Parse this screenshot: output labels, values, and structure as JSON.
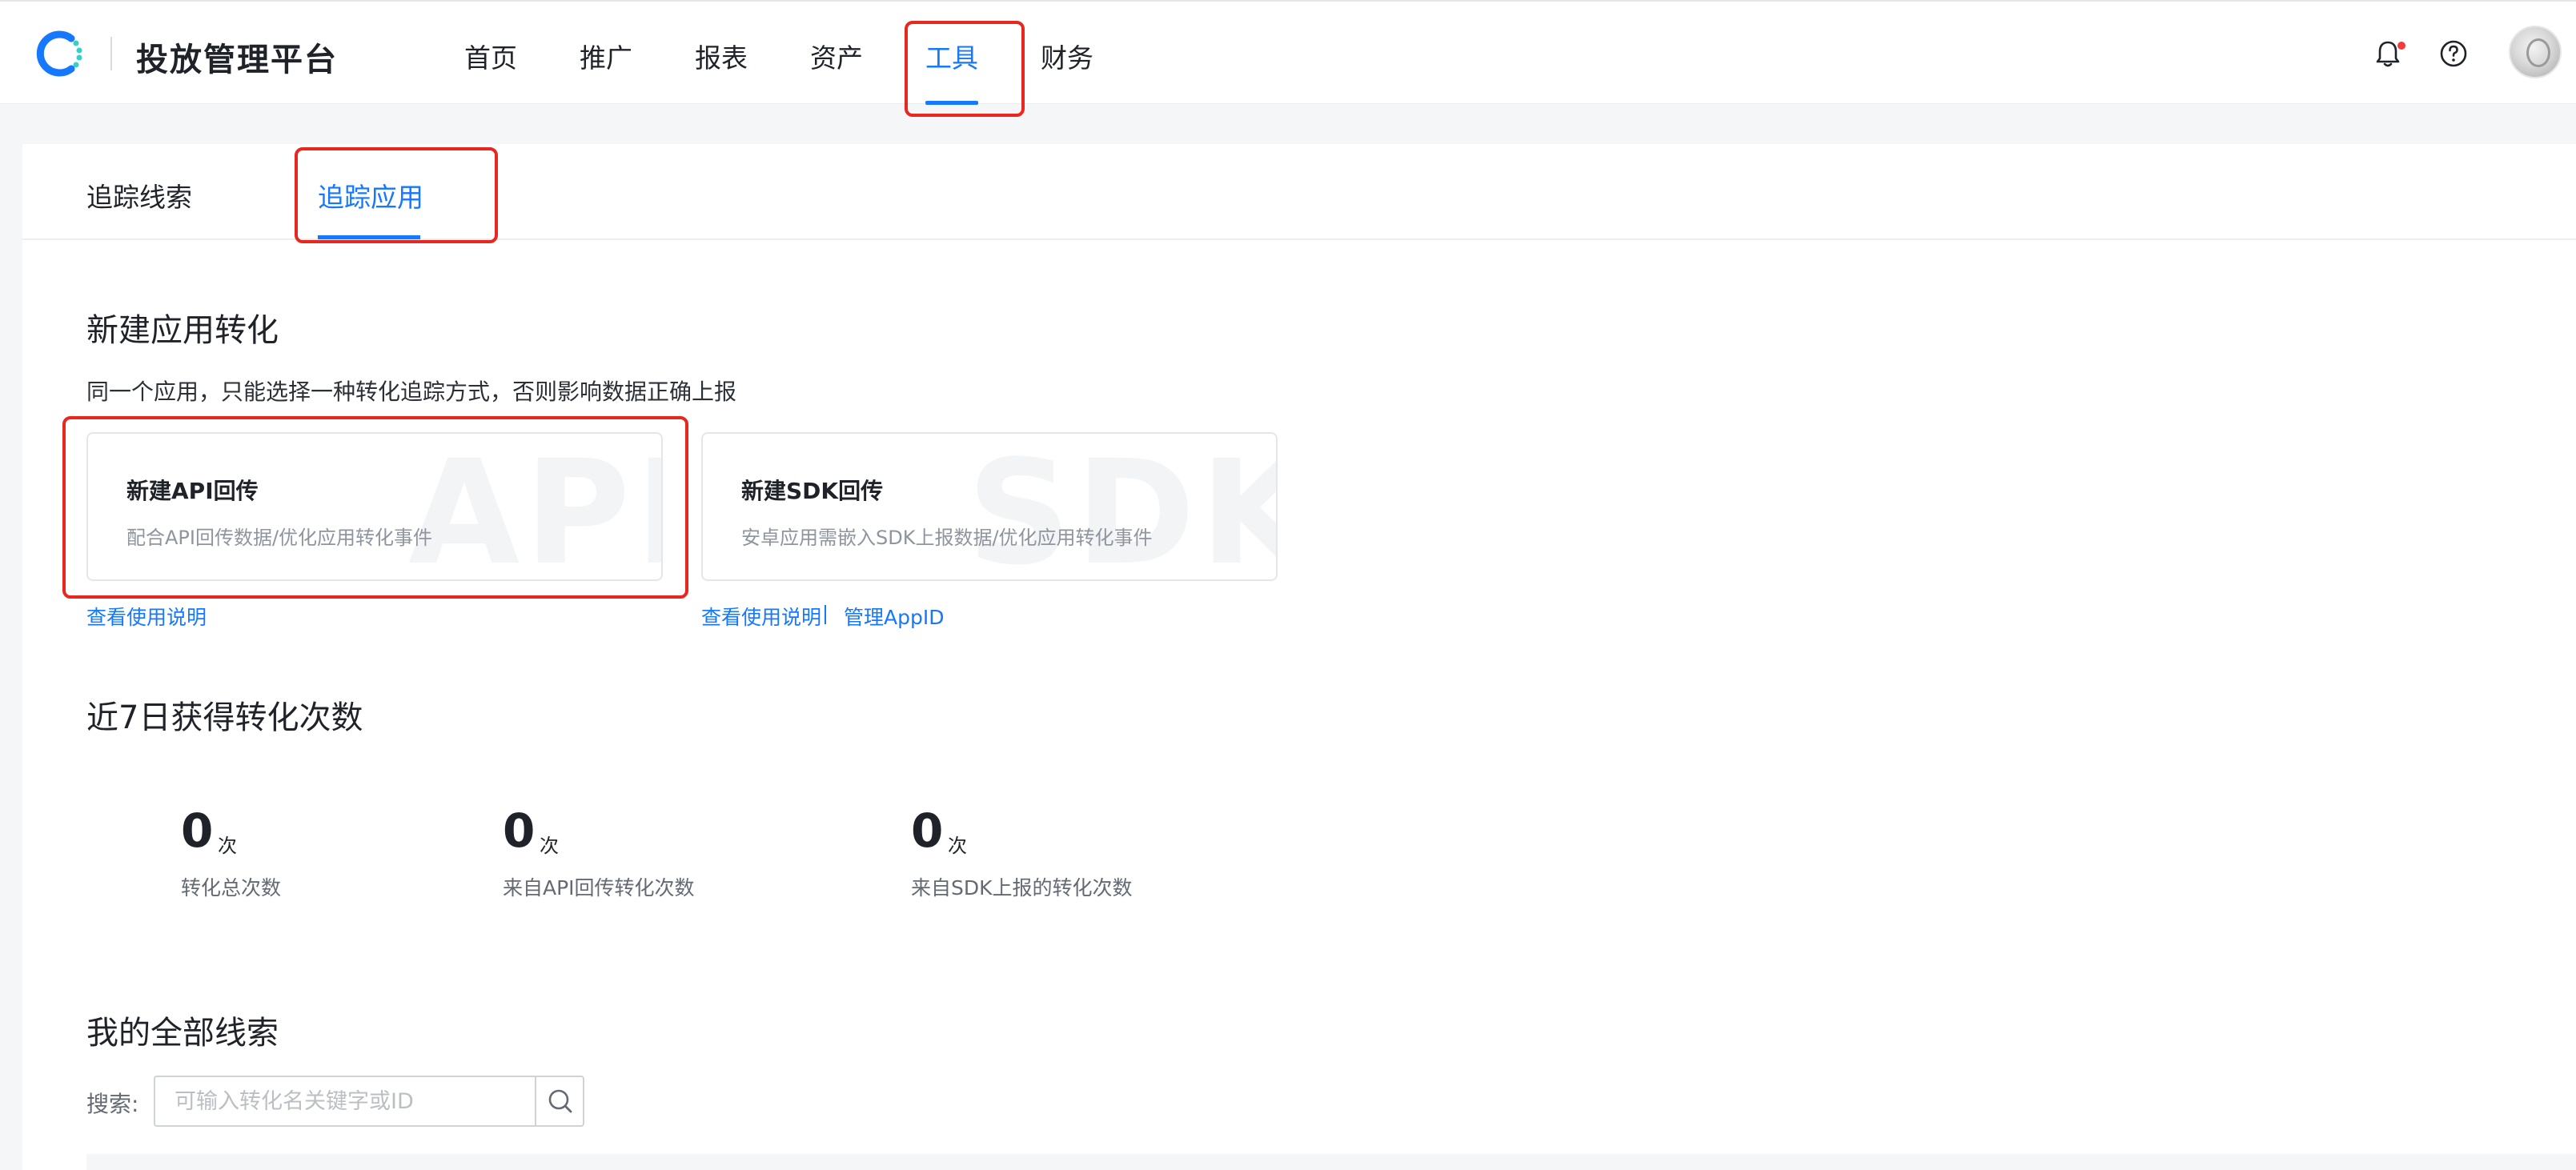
{
  "header": {
    "title": "投放管理平台",
    "nav": [
      {
        "label": "首页"
      },
      {
        "label": "推广"
      },
      {
        "label": "报表"
      },
      {
        "label": "资产"
      },
      {
        "label": "工具"
      },
      {
        "label": "财务"
      }
    ],
    "active_nav": "工具",
    "icons": [
      "bell-icon",
      "help-icon",
      "avatar"
    ]
  },
  "tabs": [
    {
      "label": "追踪线索"
    },
    {
      "label": "追踪应用"
    }
  ],
  "active_tab": "追踪应用",
  "create_section": {
    "title": "新建应用转化",
    "subtitle": "同一个应用，只能选择一种转化追踪方式，否则影响数据正确上报",
    "cards": [
      {
        "title": "新建API回传",
        "desc": "配合API回传数据/优化应用转化事件",
        "watermark": "API",
        "link": "查看使用说明"
      },
      {
        "title": "新建SDK回传",
        "desc": "安卓应用需嵌入SDK上报数据/优化应用转化事件",
        "watermark": "SDK",
        "link": "查看使用说明",
        "link2": "管理AppID"
      }
    ]
  },
  "stats_section": {
    "title": "近7日获得转化次数",
    "unit": "次",
    "stats": [
      {
        "value": "0",
        "label": "转化总次数"
      },
      {
        "value": "0",
        "label": "来自API回传转化次数"
      },
      {
        "value": "0",
        "label": "来自SDK上报的转化次数"
      }
    ]
  },
  "leads_section": {
    "title": "我的全部线索",
    "search_label": "搜索:",
    "search_placeholder": "可输入转化名关键字或ID",
    "search_value": ""
  },
  "colors": {
    "accent": "#1677ff",
    "highlight": "#e8281e",
    "notification_dot": "#f23c3c"
  }
}
